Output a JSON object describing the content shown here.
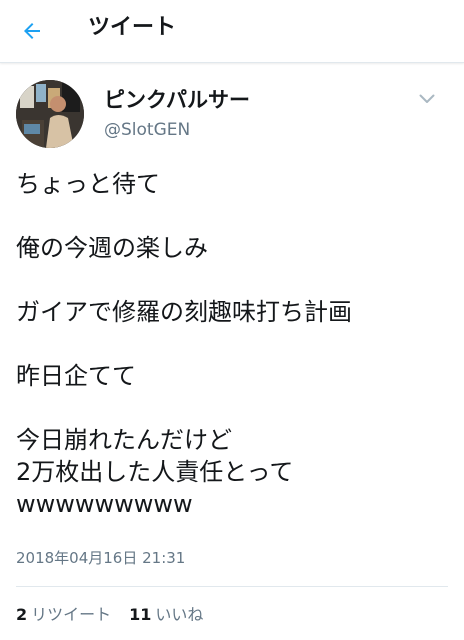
{
  "header": {
    "title": "ツイート",
    "back_icon": "arrow-left-icon",
    "accent_color": "#1da1f2"
  },
  "tweet": {
    "user": {
      "name": "ピンクパルサー",
      "handle": "@SlotGEN",
      "avatar_icon": "user-avatar"
    },
    "menu_icon": "chevron-down-icon",
    "lines": [
      "ちょっと待て",
      "",
      "俺の今週の楽しみ",
      "",
      "ガイアで修羅の刻趣味打ち計画",
      "",
      "昨日企てて",
      "",
      "今日崩れたんだけど",
      "2万枚出した人責任とって",
      "wwwwwwwww"
    ],
    "timestamp": "2018年04月16日 21:31",
    "stats": {
      "retweets_count": "2",
      "retweets_label": "リツイート",
      "likes_count": "11",
      "likes_label": "いいね"
    }
  }
}
